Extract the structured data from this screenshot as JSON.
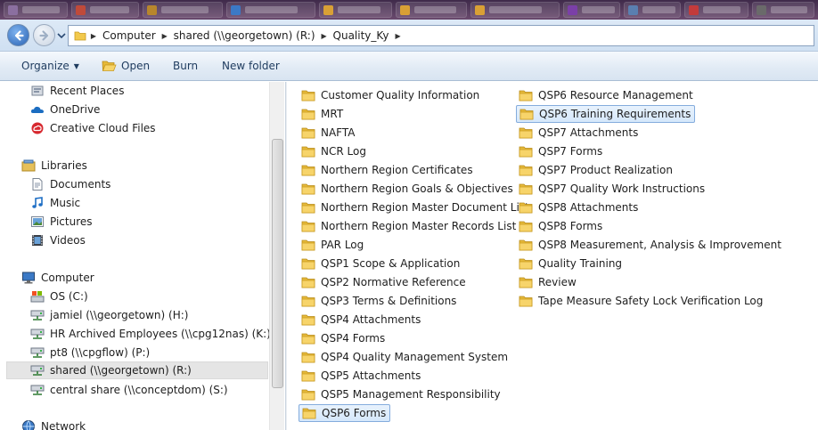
{
  "address_bar": {
    "breadcrumbs": [
      "Computer",
      "shared (\\\\georgetown) (R:)",
      "Quality_Ky"
    ]
  },
  "toolbar": {
    "organize_label": "Organize",
    "open_label": "Open",
    "burn_label": "Burn",
    "new_folder_label": "New folder"
  },
  "nav_pane": {
    "favorites": [
      {
        "label": "Recent Places",
        "icon": "recent-places-icon"
      },
      {
        "label": "OneDrive",
        "icon": "onedrive-icon"
      },
      {
        "label": "Creative Cloud Files",
        "icon": "creative-cloud-icon"
      }
    ],
    "libraries": {
      "label": "Libraries",
      "items": [
        {
          "label": "Documents",
          "icon": "documents-icon"
        },
        {
          "label": "Music",
          "icon": "music-icon"
        },
        {
          "label": "Pictures",
          "icon": "pictures-icon"
        },
        {
          "label": "Videos",
          "icon": "videos-icon"
        }
      ]
    },
    "computer": {
      "label": "Computer",
      "items": [
        {
          "label": "OS (C:)",
          "icon": "local-drive-icon"
        },
        {
          "label": "jamiel (\\\\georgetown) (H:)",
          "icon": "network-drive-icon"
        },
        {
          "label": "HR Archived Employees (\\\\cpg12nas) (K:)",
          "icon": "network-drive-icon"
        },
        {
          "label": "pt8 (\\\\cpgflow) (P:)",
          "icon": "network-drive-icon"
        },
        {
          "label": "shared (\\\\georgetown) (R:)",
          "icon": "network-drive-icon",
          "selected": true
        },
        {
          "label": "central share (\\\\conceptdom) (S:)",
          "icon": "network-drive-icon"
        }
      ]
    },
    "network": {
      "label": "Network",
      "icon": "network-icon"
    }
  },
  "files": {
    "column1": [
      "Customer Quality Information",
      "MRT",
      "NAFTA",
      "NCR  Log",
      "Northern Region Certificates",
      "Northern Region Goals & Objectives",
      "Northern Region Master Document List",
      "Northern Region Master Records List",
      "PAR Log",
      "QSP1 Scope & Application",
      "QSP2 Normative Reference",
      "QSP3 Terms & Definitions",
      "QSP4 Attachments",
      "QSP4 Forms",
      "QSP4 Quality Management System",
      "QSP5 Attachments",
      "QSP5 Management Responsibility",
      "QSP6 Forms"
    ],
    "column2": [
      "QSP6 Resource Management",
      "QSP6 Training Requirements",
      "QSP7 Attachments",
      "QSP7 Forms",
      "QSP7 Product Realization",
      "QSP7 Quality Work Instructions",
      "QSP8 Attachments",
      "QSP8 Forms",
      "QSP8 Measurement, Analysis & Improvement",
      "Quality Training",
      "Review",
      "Tape Measure  Safety Lock Verification Log"
    ],
    "selected": [
      "QSP6 Forms",
      "QSP6 Training Requirements"
    ]
  },
  "colors": {
    "selection_border": "#84acdd",
    "selection_fill": "#d6e8fb",
    "folder_yellow": "#f2c94c",
    "command_text": "#1e3b5e"
  }
}
